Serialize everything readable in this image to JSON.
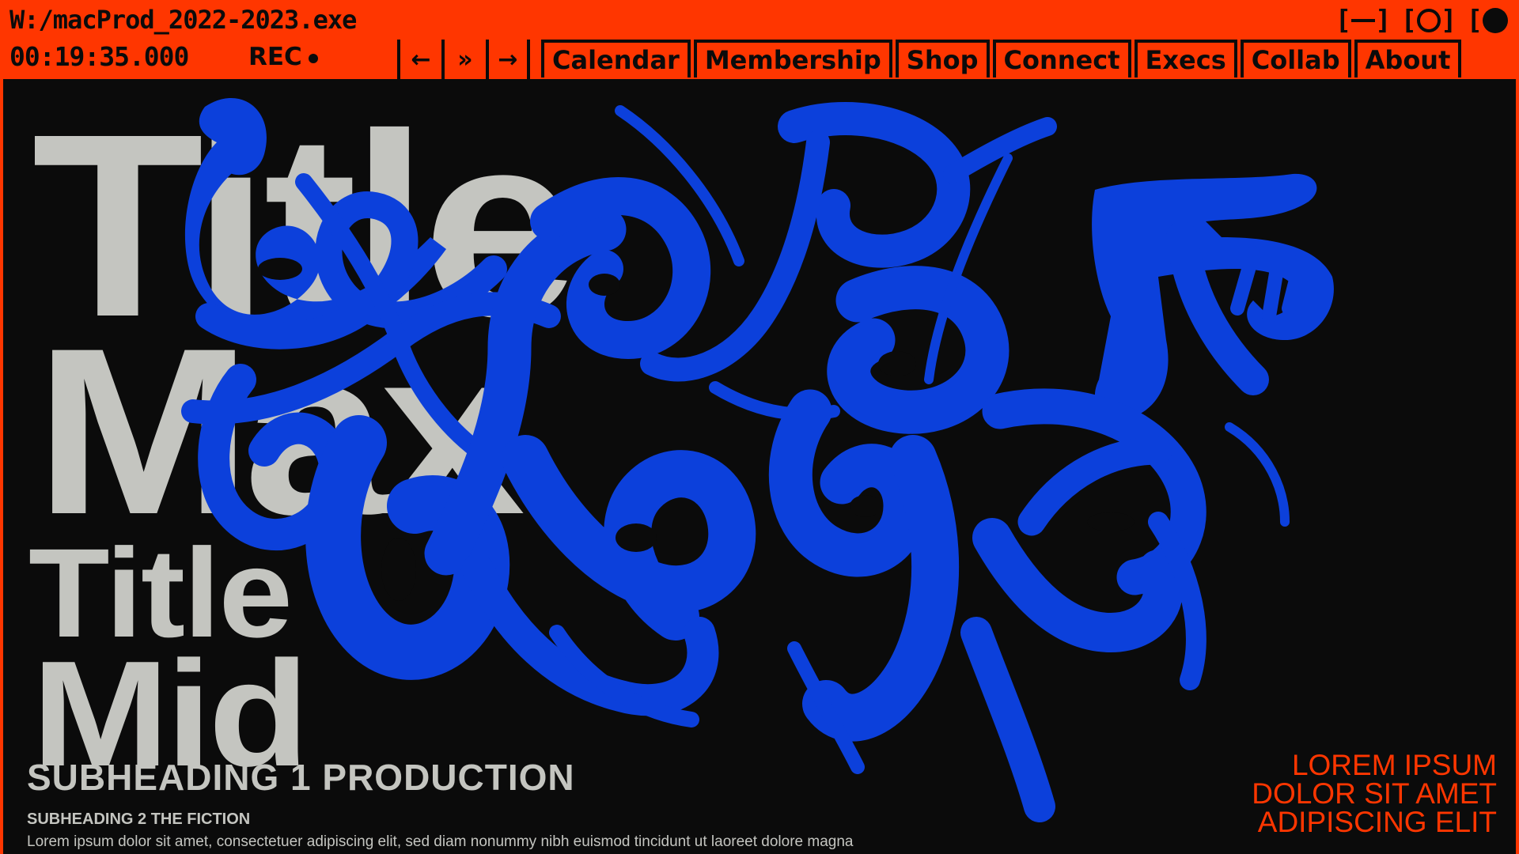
{
  "colors": {
    "accent": "#ff3600",
    "dark": "#0b0b0b",
    "title_gray": "#c4c5c0",
    "blob_blue": "#0c40db"
  },
  "window": {
    "path": "W:/macProd_2022-2023.exe",
    "controls": [
      {
        "name": "minimize",
        "icon": "minimize-icon"
      },
      {
        "name": "maximize",
        "icon": "circle-outline-icon"
      },
      {
        "name": "close",
        "icon": "filled-circle-icon"
      }
    ]
  },
  "status": {
    "timecode": "00:19:35.000",
    "rec_label": "REC"
  },
  "nav_buttons": [
    {
      "glyph": "←",
      "icon": "arrow-left-icon"
    },
    {
      "glyph": "»",
      "icon": "double-chevron-right-icon"
    },
    {
      "glyph": "→",
      "icon": "arrow-right-icon"
    }
  ],
  "menu": [
    "Calendar",
    "Membership",
    "Shop",
    "Connect",
    "Execs",
    "Collab",
    "About"
  ],
  "hero": {
    "title_line1": "Title",
    "title_line2": "Max",
    "title_line3": "Title",
    "title_line4": "Mid",
    "subheading1": "SUBHEADING 1 PRODUCTION",
    "subheading2": "SUBHEADING 2 THE FICTION",
    "body": "Lorem ipsum dolor sit amet, consectetuer adipiscing elit, sed diam nonummy nibh euismod tincidunt ut laoreet dolore magna"
  },
  "side_text": [
    "LOREM IPSUM",
    "DOLOR SIT AMET",
    "ADIPISCING ELIT"
  ]
}
